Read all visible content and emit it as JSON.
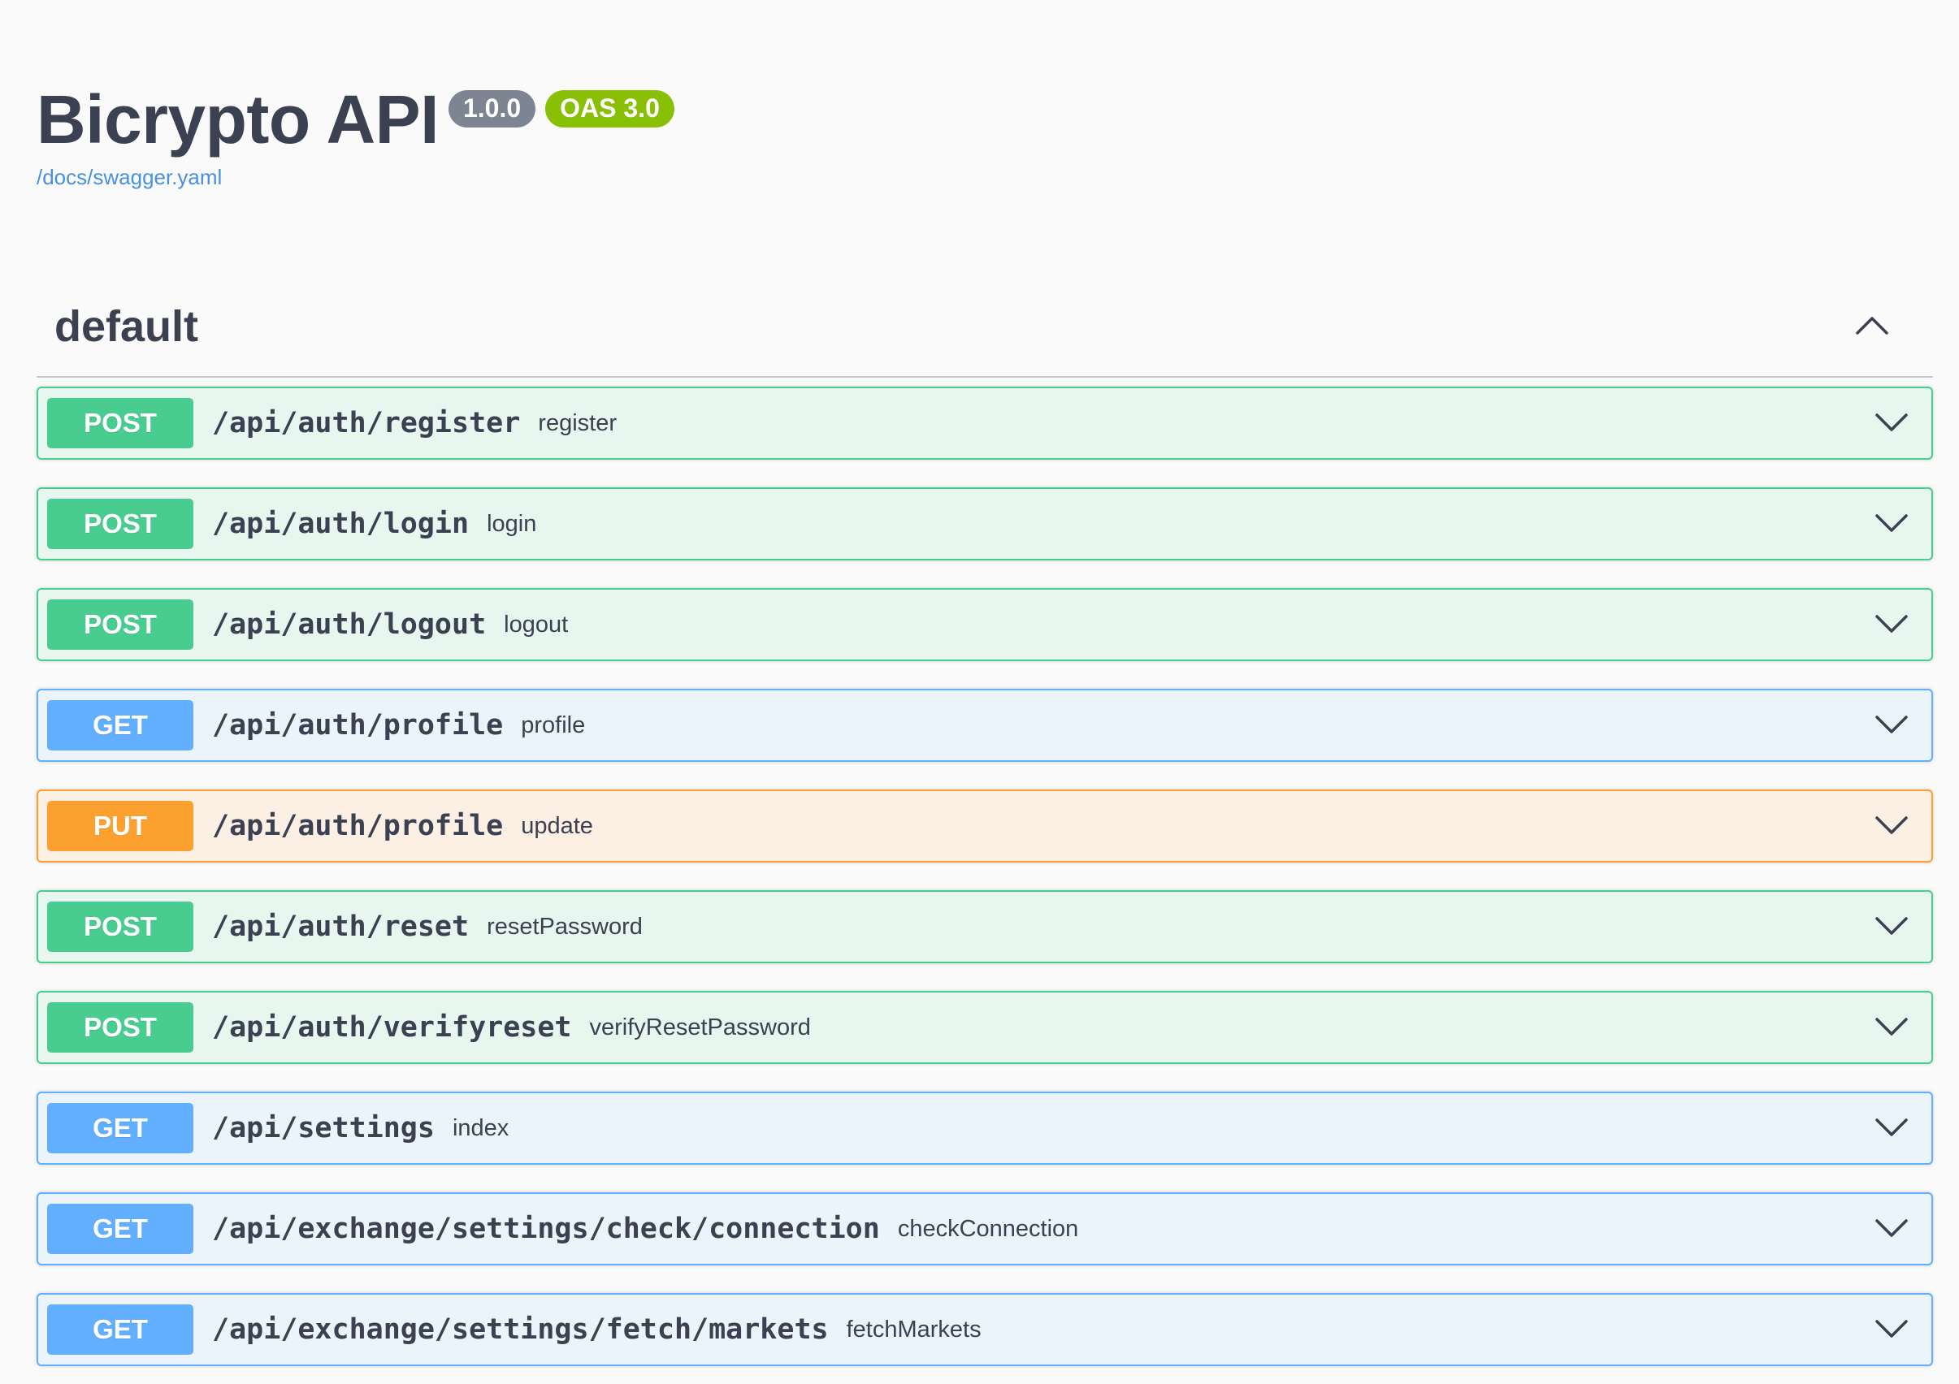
{
  "info": {
    "title": "Bicrypto API",
    "version": "1.0.0",
    "oas": "OAS 3.0",
    "spec_url": "/docs/swagger.yaml"
  },
  "section": {
    "title": "default",
    "expanded": true
  },
  "colors": {
    "post": "#49cc90",
    "get": "#61affe",
    "put": "#fca130",
    "link": "#4990e2"
  },
  "operations": [
    {
      "method": "POST",
      "path": "/api/auth/register",
      "summary": "register"
    },
    {
      "method": "POST",
      "path": "/api/auth/login",
      "summary": "login"
    },
    {
      "method": "POST",
      "path": "/api/auth/logout",
      "summary": "logout"
    },
    {
      "method": "GET",
      "path": "/api/auth/profile",
      "summary": "profile"
    },
    {
      "method": "PUT",
      "path": "/api/auth/profile",
      "summary": "update"
    },
    {
      "method": "POST",
      "path": "/api/auth/reset",
      "summary": "resetPassword"
    },
    {
      "method": "POST",
      "path": "/api/auth/verifyreset",
      "summary": "verifyResetPassword"
    },
    {
      "method": "GET",
      "path": "/api/settings",
      "summary": "index"
    },
    {
      "method": "GET",
      "path": "/api/exchange/settings/check/connection",
      "summary": "checkConnection"
    },
    {
      "method": "GET",
      "path": "/api/exchange/settings/fetch/markets",
      "summary": "fetchMarkets"
    }
  ]
}
